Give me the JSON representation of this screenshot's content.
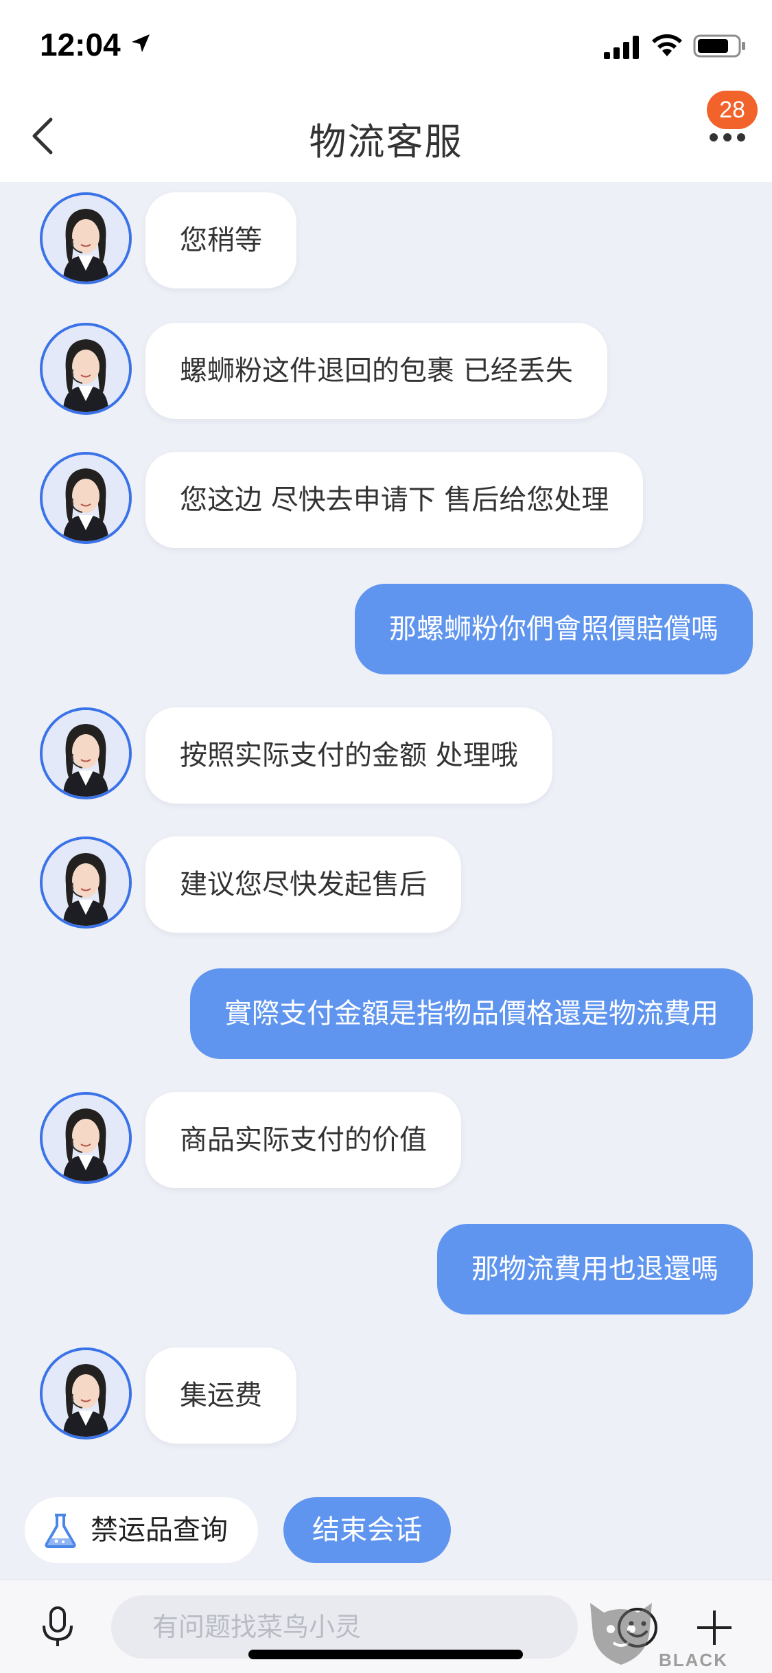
{
  "status_bar": {
    "time": "12:04"
  },
  "header": {
    "title": "物流客服",
    "badge_count": "28"
  },
  "messages": [
    {
      "from": "agent",
      "text": "您稍等"
    },
    {
      "from": "agent",
      "text": "螺蛳粉这件退回的包裹 已经丢失"
    },
    {
      "from": "agent",
      "text": "您这边 尽快去申请下 售后给您处理"
    },
    {
      "from": "user",
      "text": "那螺蛳粉你們會照價賠償嗎"
    },
    {
      "from": "agent",
      "text": "按照实际支付的金额 处理哦"
    },
    {
      "from": "agent",
      "text": "建议您尽快发起售后"
    },
    {
      "from": "user",
      "text": "實際支付金額是指物品價格還是物流費用"
    },
    {
      "from": "agent",
      "text": "商品实际支付的价值"
    },
    {
      "from": "user",
      "text": "那物流費用也退還嗎"
    },
    {
      "from": "agent",
      "text": "集运费"
    }
  ],
  "quick_actions": {
    "contraband": "禁运品查询",
    "end_session": "结束会话"
  },
  "input": {
    "placeholder": "有问题找菜鸟小灵"
  },
  "watermark": {
    "cn": "黑猫",
    "en": "BLACK CAT"
  },
  "colors": {
    "accent": "#5f95ef",
    "badge": "#f2632c",
    "avatar_ring": "#3a72e8",
    "background": "#eef0f7"
  }
}
